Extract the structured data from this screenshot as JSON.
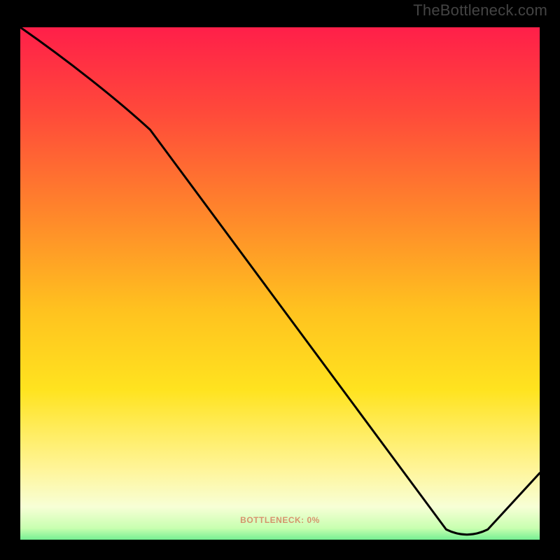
{
  "watermark": "TheBottleneck.com",
  "bottom_label": "BOTTLENECK: 0%",
  "chart_data": {
    "type": "line",
    "title": "",
    "xlabel": "",
    "ylabel": "",
    "xlim": [
      0,
      100
    ],
    "ylim": [
      0,
      100
    ],
    "gradient_colors": {
      "top": "#ff1a4b",
      "mid_upper": "#ff7a2a",
      "mid": "#ffd21f",
      "mid_lower": "#fff59a",
      "near_bottom": "#f7ffd6",
      "bottom": "#2fe07a"
    },
    "series": [
      {
        "name": "bottleneck-curve",
        "x": [
          0,
          25,
          82,
          90,
          100
        ],
        "y": [
          100,
          80,
          2,
          2,
          13
        ]
      }
    ],
    "optimum_band": {
      "x_start": 80,
      "x_end": 92,
      "y": 2
    }
  }
}
